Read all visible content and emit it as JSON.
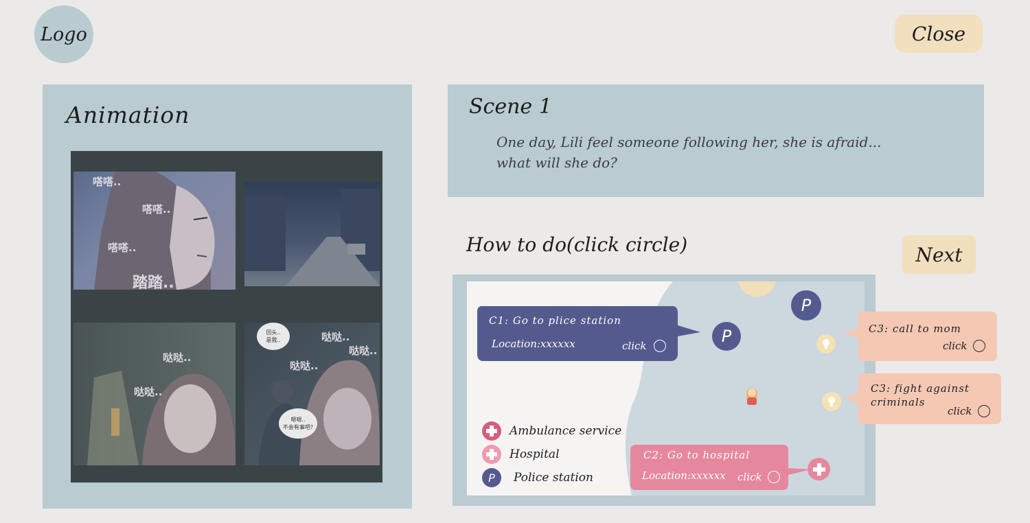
{
  "header": {
    "logo": "Logo",
    "close_label": "Close"
  },
  "animation": {
    "title": "Animation",
    "sfx": [
      "嗒嗒..",
      "嗒嗒..",
      "嗒嗒..",
      "踏踏..",
      "哒哒..",
      "哒哒..",
      "哒哒..",
      "哒哒..",
      "哒哒.."
    ],
    "speech": [
      "回头..\n是我..",
      "嗯嗯..\n不会有事吧?"
    ]
  },
  "scene": {
    "title": "Scene 1",
    "line1": "One day, Lili feel someone following her, she is afraid...",
    "line2": "what will she do?"
  },
  "howto": {
    "title": "How to do(click circle)",
    "next_label": "Next"
  },
  "map": {
    "c1": {
      "title": "C1: Go to plice station",
      "location": "Location:xxxxxx",
      "click": "click"
    },
    "c2": {
      "title": "C2: Go to hospital",
      "location": "Location:xxxxxx",
      "click": "click"
    },
    "c3a": {
      "title": "C3: call to mom",
      "click": "click"
    },
    "c3b": {
      "title": "C3: fight against criminals",
      "click": "click"
    },
    "police_symbol": "P",
    "legend": [
      {
        "icon": "ambulance",
        "label": "Ambulance service"
      },
      {
        "icon": "hospital",
        "label": "Hospital"
      },
      {
        "icon": "police",
        "label": "Police station"
      }
    ]
  },
  "colors": {
    "background": "#ebeae8",
    "panel": "#bacbd1",
    "button": "#f1dfbe",
    "police": "#555a8e",
    "hospital": "#e6889d",
    "call_bubble": "#f5c8b4"
  }
}
